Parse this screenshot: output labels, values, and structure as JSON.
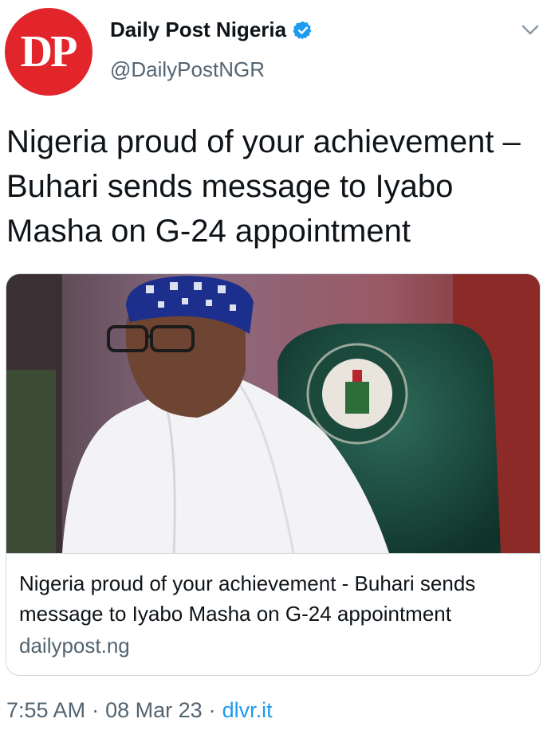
{
  "author": {
    "avatar_text": "DP",
    "display_name": "Daily Post Nigeria",
    "handle": "@DailyPostNGR",
    "verified": true,
    "verified_icon": "verified-badge-icon",
    "menu_icon": "chevron-down-icon"
  },
  "tweet": {
    "text": "Nigeria proud of your achievement – Buhari sends message to Iyabo Masha on G-24 appointment"
  },
  "card": {
    "image_alt": "photo of man in white attire and blue cap seated in green chair with presidential seal",
    "title": "Nigeria proud of your achievement - Buhari sends message to Iyabo Masha on G-24 appointment",
    "domain": "dailypost.ng"
  },
  "meta": {
    "time": "7:55 AM",
    "date": "08 Mar 23",
    "separator": "·",
    "source": "dlvr.it"
  },
  "colors": {
    "brand_red": "#e1252b",
    "link_blue": "#1d9bf0",
    "secondary_text": "#536471",
    "border": "#cfd9de"
  }
}
